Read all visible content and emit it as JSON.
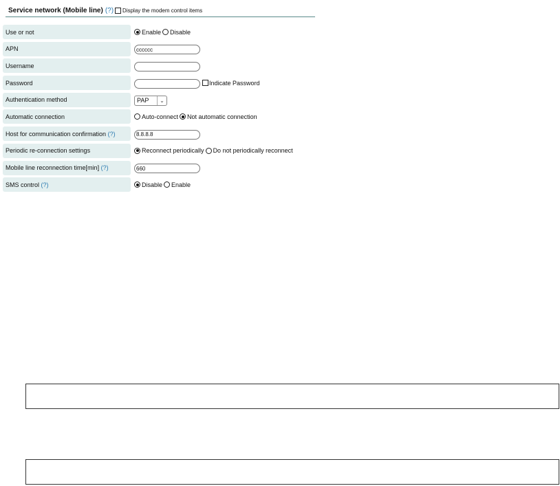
{
  "header": {
    "title": "Service network (Mobile line)",
    "help": "(?)",
    "modem_check_label": "Display the modem control items"
  },
  "rows": [
    {
      "label": "Use or not",
      "options": [
        "Enable",
        "Disable"
      ],
      "selected": 0
    },
    {
      "label": "APN",
      "value": "cccccc"
    },
    {
      "label": "Username",
      "value": ""
    },
    {
      "label": "Password",
      "value": "",
      "check_label": "Indicate Password"
    },
    {
      "label": "Authentication method",
      "select": "PAP"
    },
    {
      "label": "Automatic connection",
      "options": [
        "Auto-connect",
        "Not automatic connection"
      ],
      "selected": 1
    },
    {
      "label": "Host for communication confirmation",
      "help": "(?)",
      "value": "8.8.8.8"
    },
    {
      "label": "Periodic re-connection settings",
      "options": [
        "Reconnect periodically",
        "Do not periodically reconnect"
      ],
      "selected": 0
    },
    {
      "label": "Mobile line reconnection time[min]",
      "help": "(?)",
      "value": "660"
    },
    {
      "label": "SMS control",
      "help": "(?)",
      "options": [
        "Disable",
        "Enable"
      ],
      "selected": 0
    }
  ],
  "icons": {
    "select_caret": "chevron-down-icon"
  }
}
